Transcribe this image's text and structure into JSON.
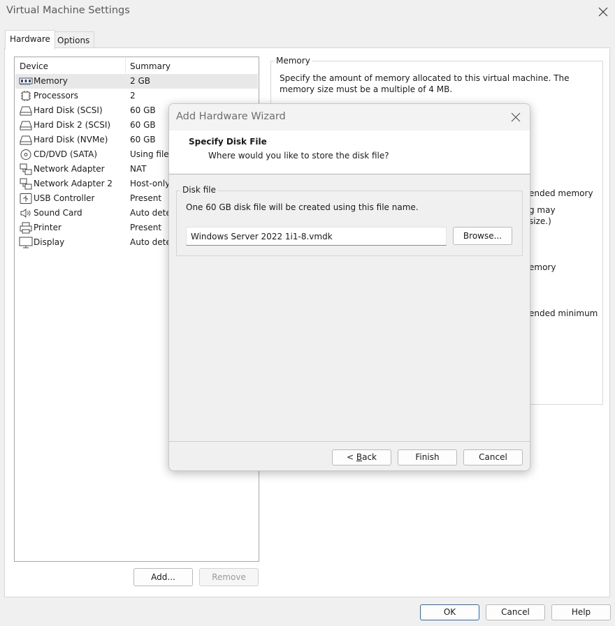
{
  "window": {
    "title": "Virtual Machine Settings"
  },
  "tabs": [
    {
      "label": "Hardware"
    },
    {
      "label": "Options"
    }
  ],
  "device_list": {
    "headers": {
      "device": "Device",
      "summary": "Summary"
    },
    "rows": [
      {
        "icon": "memory-icon",
        "name": "Memory",
        "summary": "2 GB",
        "selected": true
      },
      {
        "icon": "processor-icon",
        "name": "Processors",
        "summary": "2"
      },
      {
        "icon": "hard-disk-icon",
        "name": "Hard Disk (SCSI)",
        "summary": "60 GB"
      },
      {
        "icon": "hard-disk-icon",
        "name": "Hard Disk 2 (SCSI)",
        "summary": "60 GB"
      },
      {
        "icon": "hard-disk-icon",
        "name": "Hard Disk (NVMe)",
        "summary": "60 GB"
      },
      {
        "icon": "cd-dvd-icon",
        "name": "CD/DVD (SATA)",
        "summary": "Using file"
      },
      {
        "icon": "network-adapter-icon",
        "name": "Network Adapter",
        "summary": "NAT"
      },
      {
        "icon": "network-adapter-icon",
        "name": "Network Adapter 2",
        "summary": "Host-only"
      },
      {
        "icon": "usb-icon",
        "name": "USB Controller",
        "summary": "Present"
      },
      {
        "icon": "sound-card-icon",
        "name": "Sound Card",
        "summary": "Auto dete"
      },
      {
        "icon": "printer-icon",
        "name": "Printer",
        "summary": "Present"
      },
      {
        "icon": "display-icon",
        "name": "Display",
        "summary": "Auto dete"
      }
    ]
  },
  "list_buttons": {
    "add": "Add...",
    "remove": "Remove"
  },
  "memory_panel": {
    "legend": "Memory",
    "description": "Specify the amount of memory allocated to this virtual machine. The memory size must be a multiple of 4 MB.",
    "partial_texts": [
      "ended memory",
      "g may",
      "size.)",
      "emory",
      "ended minimum"
    ]
  },
  "footer_buttons": {
    "ok": "OK",
    "cancel": "Cancel",
    "help": "Help"
  },
  "wizard": {
    "title": "Add Hardware Wizard",
    "header_title": "Specify Disk File",
    "header_subtitle": "Where would you like to store the disk file?",
    "group_legend": "Disk file",
    "description": "One 60 GB disk file will be created using this file name.",
    "file_name": "Windows Server 2022 1i1-8.vmdk",
    "browse": "Browse...",
    "back_prefix": "< ",
    "back_access": "B",
    "back_rest": "ack",
    "finish": "Finish",
    "cancel": "Cancel"
  }
}
